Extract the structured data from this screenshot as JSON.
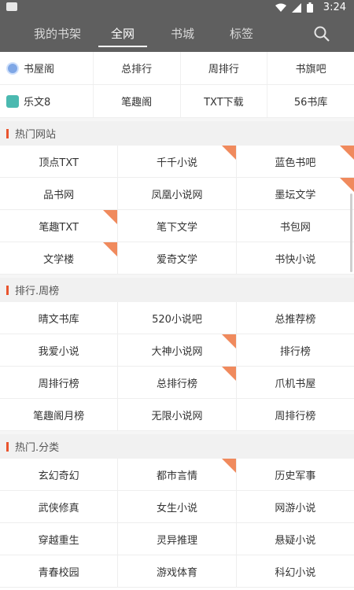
{
  "status": {
    "time": "3:24"
  },
  "tabs": [
    {
      "label": "我的书架"
    },
    {
      "label": "全网"
    },
    {
      "label": "书城"
    },
    {
      "label": "标签"
    }
  ],
  "top_links": [
    [
      "书屋阁",
      "总排行",
      "周排行",
      "书旗吧"
    ],
    [
      "乐文8",
      "笔趣阁",
      "TXT下载",
      "56书库"
    ]
  ],
  "sections": [
    {
      "title": "热门网站",
      "rows": [
        [
          {
            "t": "顶点TXT",
            "hot": false
          },
          {
            "t": "千千小说",
            "hot": true
          },
          {
            "t": "蓝色书吧",
            "hot": true
          }
        ],
        [
          {
            "t": "品书网",
            "hot": false
          },
          {
            "t": "凤凰小说网",
            "hot": false
          },
          {
            "t": "墨坛文学",
            "hot": true
          }
        ],
        [
          {
            "t": "笔趣TXT",
            "hot": true
          },
          {
            "t": "笔下文学",
            "hot": false
          },
          {
            "t": "书包网",
            "hot": false
          }
        ],
        [
          {
            "t": "文学楼",
            "hot": true
          },
          {
            "t": "爱奇文学",
            "hot": false
          },
          {
            "t": "书快小说",
            "hot": false
          }
        ]
      ]
    },
    {
      "title": "排行.周榜",
      "rows": [
        [
          {
            "t": "晴文书库",
            "hot": false
          },
          {
            "t": "520小说吧",
            "hot": false
          },
          {
            "t": "总推荐榜",
            "hot": false
          }
        ],
        [
          {
            "t": "我爱小说",
            "hot": false
          },
          {
            "t": "大神小说网",
            "hot": true
          },
          {
            "t": "排行榜",
            "hot": false
          }
        ],
        [
          {
            "t": "周排行榜",
            "hot": false
          },
          {
            "t": "总排行榜",
            "hot": true
          },
          {
            "t": "爪机书屋",
            "hot": false
          }
        ],
        [
          {
            "t": "笔趣阁月榜",
            "hot": false
          },
          {
            "t": "无限小说网",
            "hot": false
          },
          {
            "t": "周排行榜",
            "hot": false
          }
        ]
      ]
    },
    {
      "title": "热门.分类",
      "rows": [
        [
          {
            "t": "玄幻奇幻",
            "hot": false
          },
          {
            "t": "都市言情",
            "hot": true
          },
          {
            "t": "历史军事",
            "hot": false
          }
        ],
        [
          {
            "t": "武侠修真",
            "hot": false
          },
          {
            "t": "女生小说",
            "hot": false
          },
          {
            "t": "网游小说",
            "hot": false
          }
        ],
        [
          {
            "t": "穿越重生",
            "hot": false
          },
          {
            "t": "灵异推理",
            "hot": false
          },
          {
            "t": "悬疑小说",
            "hot": false
          }
        ],
        [
          {
            "t": "青春校园",
            "hot": false
          },
          {
            "t": "游戏体育",
            "hot": false
          },
          {
            "t": "科幻小说",
            "hot": false
          }
        ]
      ]
    }
  ],
  "colors": {
    "header": "#5f5f5f",
    "accent": "#e9542e",
    "hot_corner": "#f08a5d"
  },
  "icons": {
    "search": "search-icon",
    "site1": "globe-icon",
    "site2": "leaf-icon"
  }
}
